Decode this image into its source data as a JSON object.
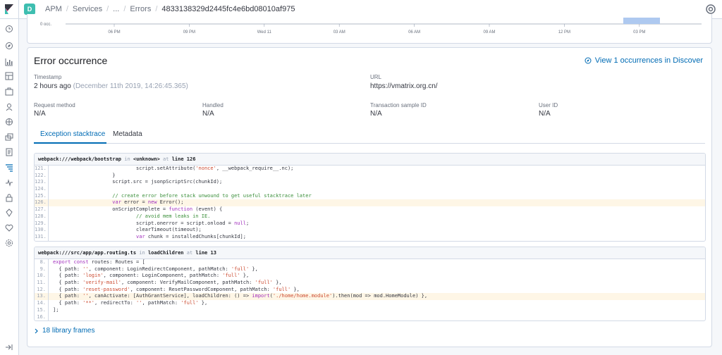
{
  "header": {
    "space_initial": "D",
    "breadcrumbs": [
      "APM",
      "Services",
      "...",
      "Errors",
      "4833138329d2445fc4e6bd08010af975"
    ]
  },
  "chart": {
    "y_label": "0 occ.",
    "x_ticks": [
      "06 PM",
      "09 PM",
      "Wed 11",
      "03 AM",
      "06 AM",
      "09 AM",
      "12 PM",
      "03 PM"
    ]
  },
  "occurrence": {
    "title": "Error occurrence",
    "discover_link": "View 1 occurrences in Discover",
    "timestamp_label": "Timestamp",
    "timestamp_value": "2 hours ago",
    "timestamp_detail": "(December 11th 2019, 14:26:45.365)",
    "url_label": "URL",
    "url_value": "https://vmatrix.org.cn/",
    "request_method_label": "Request method",
    "request_method_value": "N/A",
    "handled_label": "Handled",
    "handled_value": "N/A",
    "transaction_label": "Transaction sample ID",
    "transaction_value": "N/A",
    "user_label": "User ID",
    "user_value": "N/A"
  },
  "tabs": [
    {
      "label": "Exception stacktrace",
      "active": true
    },
    {
      "label": "Metadata",
      "active": false
    }
  ],
  "frames": [
    {
      "file": "webpack:///webpack/bootstrap",
      "in_word": "in",
      "func": "<unknown>",
      "at_word": "at",
      "line_text": "line 126",
      "lines": [
        {
          "n": "121.",
          "code": "                            script.setAttribute('nonce', __webpack_require__.nc);",
          "hl": false
        },
        {
          "n": "122.",
          "code": "                    }",
          "hl": false
        },
        {
          "n": "123.",
          "code": "                    script.src = jsonpScriptSrc(chunkId);",
          "hl": false
        },
        {
          "n": "124.",
          "code": "",
          "hl": false
        },
        {
          "n": "125.",
          "code": "                    // create error before stack unwound to get useful stacktrace later",
          "hl": false
        },
        {
          "n": "126.",
          "code": "                    var error = new Error();",
          "hl": true
        },
        {
          "n": "127.",
          "code": "                    onScriptComplete = function (event) {",
          "hl": false
        },
        {
          "n": "128.",
          "code": "                            // avoid mem leaks in IE.",
          "hl": false
        },
        {
          "n": "129.",
          "code": "                            script.onerror = script.onload = null;",
          "hl": false
        },
        {
          "n": "130.",
          "code": "                            clearTimeout(timeout);",
          "hl": false
        },
        {
          "n": "131.",
          "code": "                            var chunk = installedChunks[chunkId];",
          "hl": false
        }
      ]
    },
    {
      "file": "webpack:///src/app/app.routing.ts",
      "in_word": "in",
      "func": "loadChildren",
      "at_word": "at",
      "line_text": "line 13",
      "lines": [
        {
          "n": "8.",
          "code": "export const routes: Routes = [",
          "hl": false
        },
        {
          "n": "9.",
          "code": "  { path: '', component: LoginRedirectComponent, pathMatch: 'full' },",
          "hl": false
        },
        {
          "n": "10.",
          "code": "  { path: 'login', component: LoginComponent, pathMatch: 'full' },",
          "hl": false
        },
        {
          "n": "11.",
          "code": "  { path: 'verify-mail', component: VerifyMailComponent, pathMatch: 'full' },",
          "hl": false
        },
        {
          "n": "12.",
          "code": "  { path: 'reset-password', component: ResetPasswordComponent, pathMatch: 'full' },",
          "hl": false
        },
        {
          "n": "13.",
          "code": "  { path: '', canActivate: [AuthGrantService], loadChildren: () => import('./home/home.module').then(mod => mod.HomeModule) },",
          "hl": true
        },
        {
          "n": "14.",
          "code": "  { path: '**', redirectTo: '', pathMatch: 'full' },",
          "hl": false
        },
        {
          "n": "15.",
          "code": "];",
          "hl": false
        },
        {
          "n": "16.",
          "code": "",
          "hl": false
        }
      ]
    }
  ],
  "library_frames": "18 library frames",
  "colors": {
    "accent": "#006bb4",
    "bar": "#aec9f0",
    "highlight": "#fef6e6"
  },
  "icons": [
    "kibana-logo-icon",
    "help-icon",
    "recent-icon",
    "discover-icon",
    "visualize-icon",
    "dashboard-icon",
    "canvas-icon",
    "maps-icon",
    "ml-icon",
    "infra-icon",
    "logs-icon",
    "apm-icon",
    "uptime-icon",
    "siem-icon",
    "dev-tools-icon",
    "monitoring-icon",
    "management-icon",
    "collapse-icon",
    "discover-link-icon",
    "chevron-right-icon"
  ]
}
